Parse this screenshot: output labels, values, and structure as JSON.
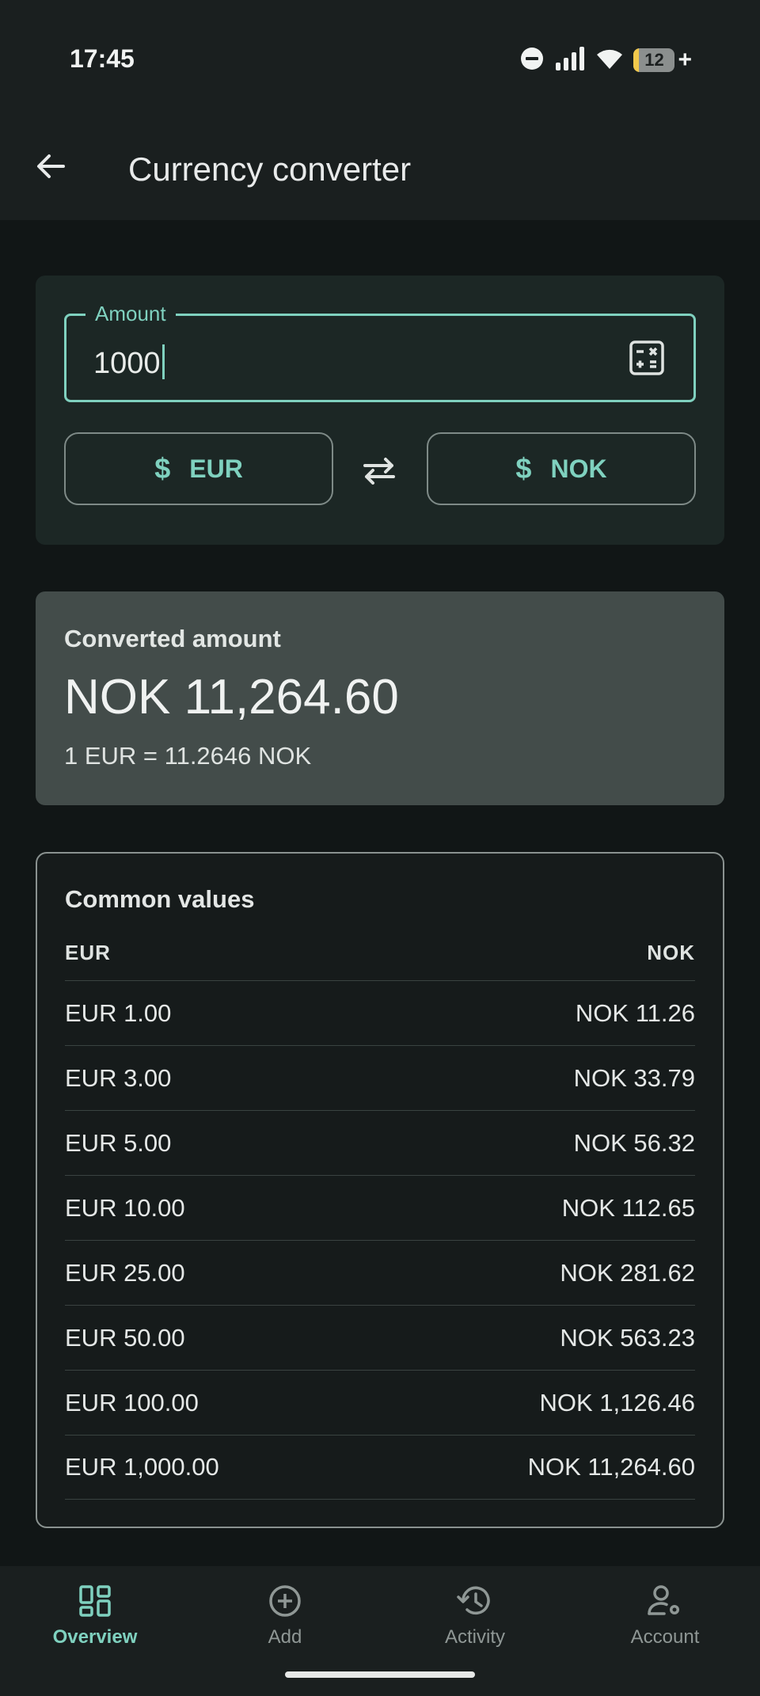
{
  "status_bar": {
    "time": "17:45",
    "battery_level": "12",
    "battery_fraction": 0.12,
    "icons": [
      "do-not-disturb-icon",
      "signal-icon",
      "wifi-icon",
      "battery-icon"
    ]
  },
  "app_bar": {
    "title": "Currency converter",
    "back_icon": "arrow-left-icon"
  },
  "converter": {
    "amount_label": "Amount",
    "amount_value": "1000",
    "calculator_icon": "calculator-icon",
    "from_currency": "EUR",
    "to_currency": "NOK",
    "currency_symbol": "$",
    "swap_icon": "swap-icon"
  },
  "result": {
    "label": "Converted amount",
    "value": "NOK 11,264.60",
    "rate": "1 EUR = 11.2646 NOK"
  },
  "common_values": {
    "title": "Common values",
    "header_from": "EUR",
    "header_to": "NOK",
    "rows": [
      {
        "from": "EUR 1.00",
        "to": "NOK 11.26"
      },
      {
        "from": "EUR 3.00",
        "to": "NOK 33.79"
      },
      {
        "from": "EUR 5.00",
        "to": "NOK 56.32"
      },
      {
        "from": "EUR 10.00",
        "to": "NOK 112.65"
      },
      {
        "from": "EUR 25.00",
        "to": "NOK 281.62"
      },
      {
        "from": "EUR 50.00",
        "to": "NOK 563.23"
      },
      {
        "from": "EUR 100.00",
        "to": "NOK 1,126.46"
      },
      {
        "from": "EUR 1,000.00",
        "to": "NOK 11,264.60"
      }
    ]
  },
  "bottom_nav": {
    "items": [
      {
        "label": "Overview",
        "icon": "dashboard-icon",
        "active": true
      },
      {
        "label": "Add",
        "icon": "add-circle-icon",
        "active": false
      },
      {
        "label": "Activity",
        "icon": "history-icon",
        "active": false
      },
      {
        "label": "Account",
        "icon": "account-settings-icon",
        "active": false
      }
    ]
  },
  "colors": {
    "accent": "#7fd1bf",
    "background": "#111616",
    "surface": "#1a1f1f",
    "result_card": "#434c4a"
  }
}
